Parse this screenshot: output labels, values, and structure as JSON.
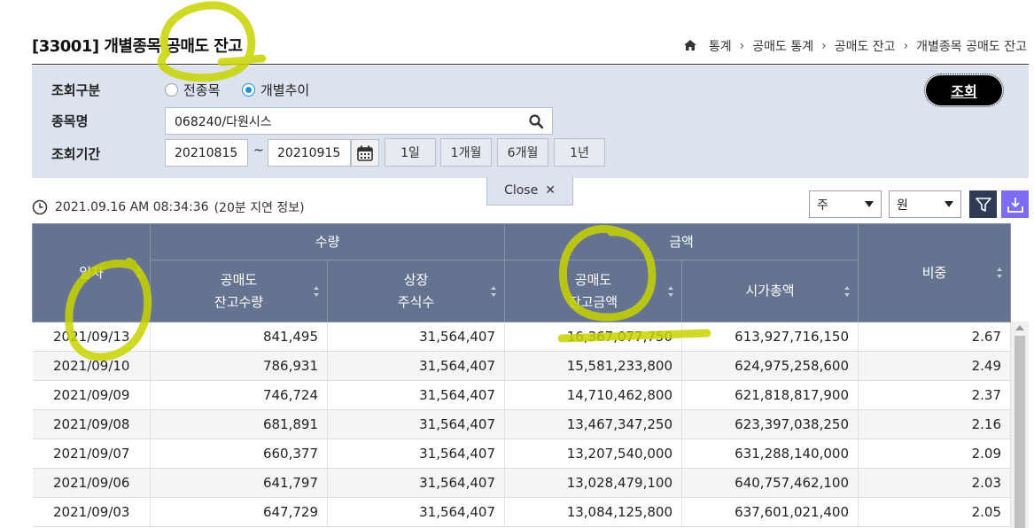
{
  "header": {
    "title": "[33001] 개별종목 공매도 잔고",
    "breadcrumb": [
      "통계",
      "공매도 통계",
      "공매도 잔고",
      "개별종목 공매도 잔고"
    ]
  },
  "search": {
    "query_type_label": "조회구분",
    "options": [
      "전종목",
      "개별추이"
    ],
    "selected_option": "개별추이",
    "stock_label": "종목명",
    "stock_value": "068240/다원시스",
    "period_label": "조회기간",
    "start_date": "20210815",
    "tilde": "~",
    "end_date": "20210915",
    "period_buttons": [
      "1일",
      "1개월",
      "6개월",
      "1년"
    ],
    "search_button": "조회",
    "close_label": "Close"
  },
  "status": {
    "timestamp": "2021.09.16 AM 08:34:36",
    "delay_note": "(20분 지연 정보)"
  },
  "filters": {
    "unit_period": "주",
    "currency": "원"
  },
  "table": {
    "headers": {
      "date": "일자",
      "group_qty": "수량",
      "group_amt": "금액",
      "ratio": "비중",
      "short_qty_1": "공매도",
      "short_qty_2": "잔고수량",
      "listed_1": "상장",
      "listed_2": "주식수",
      "short_amt_1": "공매도",
      "short_amt_2": "잔고금액",
      "market_cap": "시가총액"
    },
    "rows": [
      [
        "2021/09/13",
        "841,495",
        "31,564,407",
        "16,367,077,750",
        "613,927,716,150",
        "2.67"
      ],
      [
        "2021/09/10",
        "786,931",
        "31,564,407",
        "15,581,233,800",
        "624,975,258,600",
        "2.49"
      ],
      [
        "2021/09/09",
        "746,724",
        "31,564,407",
        "14,710,462,800",
        "621,818,817,900",
        "2.37"
      ],
      [
        "2021/09/08",
        "681,891",
        "31,564,407",
        "13,467,347,250",
        "623,397,038,250",
        "2.16"
      ],
      [
        "2021/09/07",
        "660,377",
        "31,564,407",
        "13,207,540,000",
        "631,288,140,000",
        "2.09"
      ],
      [
        "2021/09/06",
        "641,797",
        "31,564,407",
        "13,028,479,100",
        "640,757,462,100",
        "2.03"
      ],
      [
        "2021/09/03",
        "647,729",
        "31,564,407",
        "13,084,125,800",
        "637,601,021,400",
        "2.05"
      ]
    ]
  },
  "colors": {
    "panel_bg": "#dde2ef",
    "header_bg": "#667390",
    "radio_selected": "#1e90d6",
    "highlighter": "#c8d400",
    "filter_button": "#2f3b55",
    "download_button": "#7b6cf2"
  }
}
